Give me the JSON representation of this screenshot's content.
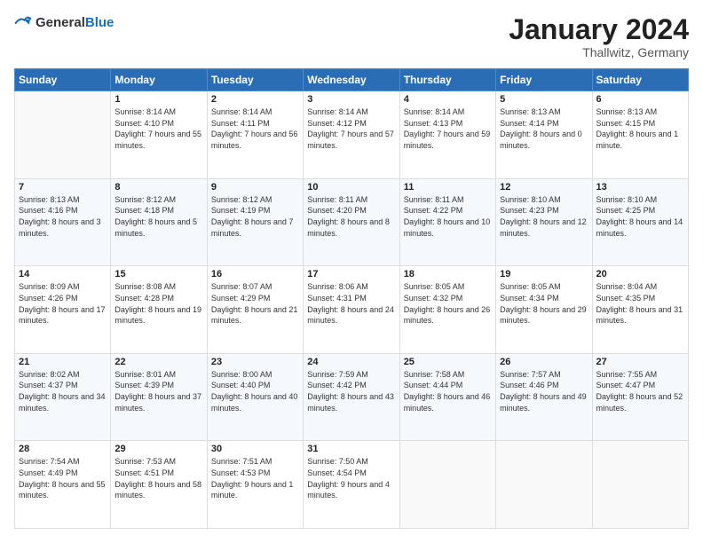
{
  "logo": {
    "general": "General",
    "blue": "Blue"
  },
  "header": {
    "month": "January 2024",
    "location": "Thallwitz, Germany"
  },
  "weekdays": [
    "Sunday",
    "Monday",
    "Tuesday",
    "Wednesday",
    "Thursday",
    "Friday",
    "Saturday"
  ],
  "weeks": [
    [
      {
        "day": "",
        "sunrise": "",
        "sunset": "",
        "daylight": ""
      },
      {
        "day": "1",
        "sunrise": "Sunrise: 8:14 AM",
        "sunset": "Sunset: 4:10 PM",
        "daylight": "Daylight: 7 hours and 55 minutes."
      },
      {
        "day": "2",
        "sunrise": "Sunrise: 8:14 AM",
        "sunset": "Sunset: 4:11 PM",
        "daylight": "Daylight: 7 hours and 56 minutes."
      },
      {
        "day": "3",
        "sunrise": "Sunrise: 8:14 AM",
        "sunset": "Sunset: 4:12 PM",
        "daylight": "Daylight: 7 hours and 57 minutes."
      },
      {
        "day": "4",
        "sunrise": "Sunrise: 8:14 AM",
        "sunset": "Sunset: 4:13 PM",
        "daylight": "Daylight: 7 hours and 59 minutes."
      },
      {
        "day": "5",
        "sunrise": "Sunrise: 8:13 AM",
        "sunset": "Sunset: 4:14 PM",
        "daylight": "Daylight: 8 hours and 0 minutes."
      },
      {
        "day": "6",
        "sunrise": "Sunrise: 8:13 AM",
        "sunset": "Sunset: 4:15 PM",
        "daylight": "Daylight: 8 hours and 1 minute."
      }
    ],
    [
      {
        "day": "7",
        "sunrise": "Sunrise: 8:13 AM",
        "sunset": "Sunset: 4:16 PM",
        "daylight": "Daylight: 8 hours and 3 minutes."
      },
      {
        "day": "8",
        "sunrise": "Sunrise: 8:12 AM",
        "sunset": "Sunset: 4:18 PM",
        "daylight": "Daylight: 8 hours and 5 minutes."
      },
      {
        "day": "9",
        "sunrise": "Sunrise: 8:12 AM",
        "sunset": "Sunset: 4:19 PM",
        "daylight": "Daylight: 8 hours and 7 minutes."
      },
      {
        "day": "10",
        "sunrise": "Sunrise: 8:11 AM",
        "sunset": "Sunset: 4:20 PM",
        "daylight": "Daylight: 8 hours and 8 minutes."
      },
      {
        "day": "11",
        "sunrise": "Sunrise: 8:11 AM",
        "sunset": "Sunset: 4:22 PM",
        "daylight": "Daylight: 8 hours and 10 minutes."
      },
      {
        "day": "12",
        "sunrise": "Sunrise: 8:10 AM",
        "sunset": "Sunset: 4:23 PM",
        "daylight": "Daylight: 8 hours and 12 minutes."
      },
      {
        "day": "13",
        "sunrise": "Sunrise: 8:10 AM",
        "sunset": "Sunset: 4:25 PM",
        "daylight": "Daylight: 8 hours and 14 minutes."
      }
    ],
    [
      {
        "day": "14",
        "sunrise": "Sunrise: 8:09 AM",
        "sunset": "Sunset: 4:26 PM",
        "daylight": "Daylight: 8 hours and 17 minutes."
      },
      {
        "day": "15",
        "sunrise": "Sunrise: 8:08 AM",
        "sunset": "Sunset: 4:28 PM",
        "daylight": "Daylight: 8 hours and 19 minutes."
      },
      {
        "day": "16",
        "sunrise": "Sunrise: 8:07 AM",
        "sunset": "Sunset: 4:29 PM",
        "daylight": "Daylight: 8 hours and 21 minutes."
      },
      {
        "day": "17",
        "sunrise": "Sunrise: 8:06 AM",
        "sunset": "Sunset: 4:31 PM",
        "daylight": "Daylight: 8 hours and 24 minutes."
      },
      {
        "day": "18",
        "sunrise": "Sunrise: 8:05 AM",
        "sunset": "Sunset: 4:32 PM",
        "daylight": "Daylight: 8 hours and 26 minutes."
      },
      {
        "day": "19",
        "sunrise": "Sunrise: 8:05 AM",
        "sunset": "Sunset: 4:34 PM",
        "daylight": "Daylight: 8 hours and 29 minutes."
      },
      {
        "day": "20",
        "sunrise": "Sunrise: 8:04 AM",
        "sunset": "Sunset: 4:35 PM",
        "daylight": "Daylight: 8 hours and 31 minutes."
      }
    ],
    [
      {
        "day": "21",
        "sunrise": "Sunrise: 8:02 AM",
        "sunset": "Sunset: 4:37 PM",
        "daylight": "Daylight: 8 hours and 34 minutes."
      },
      {
        "day": "22",
        "sunrise": "Sunrise: 8:01 AM",
        "sunset": "Sunset: 4:39 PM",
        "daylight": "Daylight: 8 hours and 37 minutes."
      },
      {
        "day": "23",
        "sunrise": "Sunrise: 8:00 AM",
        "sunset": "Sunset: 4:40 PM",
        "daylight": "Daylight: 8 hours and 40 minutes."
      },
      {
        "day": "24",
        "sunrise": "Sunrise: 7:59 AM",
        "sunset": "Sunset: 4:42 PM",
        "daylight": "Daylight: 8 hours and 43 minutes."
      },
      {
        "day": "25",
        "sunrise": "Sunrise: 7:58 AM",
        "sunset": "Sunset: 4:44 PM",
        "daylight": "Daylight: 8 hours and 46 minutes."
      },
      {
        "day": "26",
        "sunrise": "Sunrise: 7:57 AM",
        "sunset": "Sunset: 4:46 PM",
        "daylight": "Daylight: 8 hours and 49 minutes."
      },
      {
        "day": "27",
        "sunrise": "Sunrise: 7:55 AM",
        "sunset": "Sunset: 4:47 PM",
        "daylight": "Daylight: 8 hours and 52 minutes."
      }
    ],
    [
      {
        "day": "28",
        "sunrise": "Sunrise: 7:54 AM",
        "sunset": "Sunset: 4:49 PM",
        "daylight": "Daylight: 8 hours and 55 minutes."
      },
      {
        "day": "29",
        "sunrise": "Sunrise: 7:53 AM",
        "sunset": "Sunset: 4:51 PM",
        "daylight": "Daylight: 8 hours and 58 minutes."
      },
      {
        "day": "30",
        "sunrise": "Sunrise: 7:51 AM",
        "sunset": "Sunset: 4:53 PM",
        "daylight": "Daylight: 9 hours and 1 minute."
      },
      {
        "day": "31",
        "sunrise": "Sunrise: 7:50 AM",
        "sunset": "Sunset: 4:54 PM",
        "daylight": "Daylight: 9 hours and 4 minutes."
      },
      {
        "day": "",
        "sunrise": "",
        "sunset": "",
        "daylight": ""
      },
      {
        "day": "",
        "sunrise": "",
        "sunset": "",
        "daylight": ""
      },
      {
        "day": "",
        "sunrise": "",
        "sunset": "",
        "daylight": ""
      }
    ]
  ]
}
